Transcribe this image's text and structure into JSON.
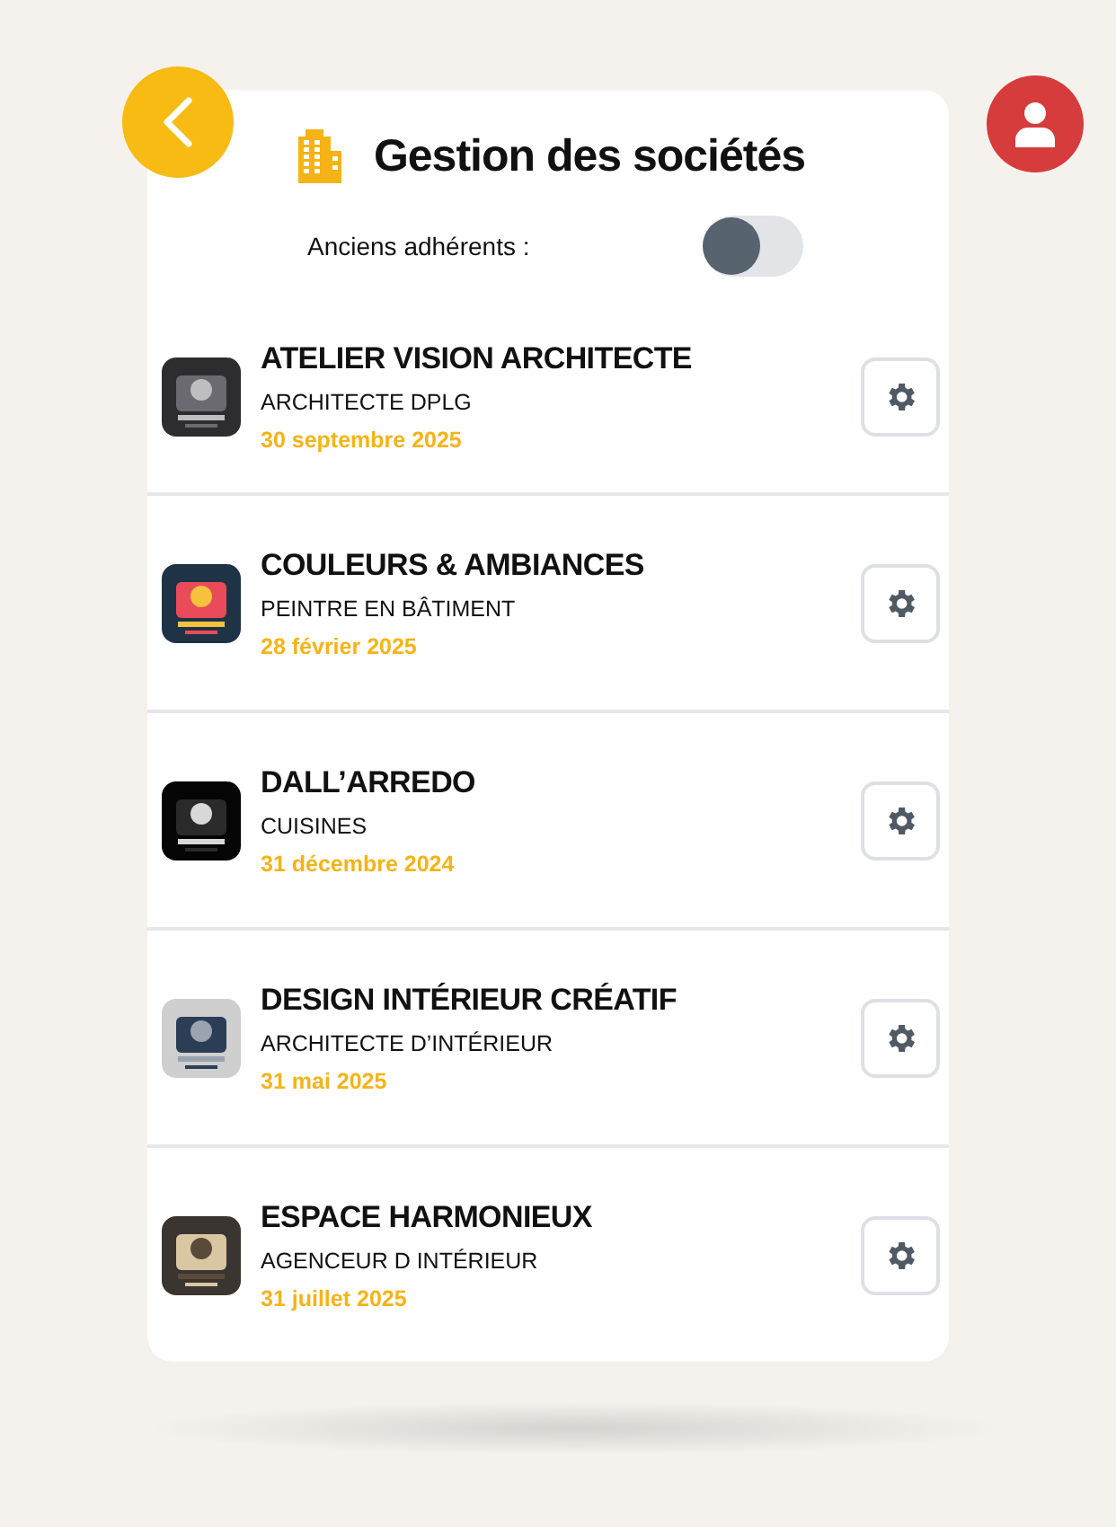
{
  "header": {
    "title": "Gestion des sociétés"
  },
  "filter": {
    "label": "Anciens adhérents :",
    "on": false
  },
  "companies": [
    {
      "name": "ATELIER VISION ARCHITECTE",
      "activity": "ARCHITECTE DPLG",
      "date": "30 septembre 2025"
    },
    {
      "name": "COULEURS & AMBIANCES",
      "activity": "PEINTRE EN BÂTIMENT",
      "date": "28 février 2025"
    },
    {
      "name": "DALL’ARREDO",
      "activity": "CUISINES",
      "date": "31 décembre 2024"
    },
    {
      "name": "DESIGN INTÉRIEUR CRÉATIF",
      "activity": "ARCHITECTE D’INTÉRIEUR",
      "date": "31 mai 2025"
    },
    {
      "name": "ESPACE HARMONIEUX",
      "activity": "AGENCEUR D INTÉRIEUR",
      "date": "31 juillet 2025"
    }
  ]
}
